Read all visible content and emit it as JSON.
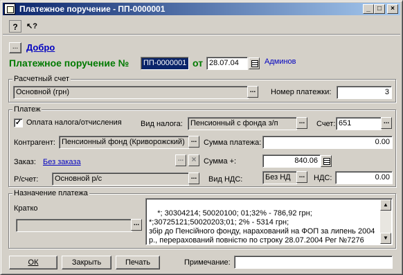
{
  "window": {
    "title": "Платежное поручение - ПП-0000001",
    "min_label": "_",
    "max_label": "□",
    "close_label": "×"
  },
  "toolbar": {
    "help_label": "?",
    "context_help_label": "↖?"
  },
  "header": {
    "status_btn": "...",
    "status_link": "Добро",
    "doc_title": "Платежное поручение №",
    "doc_number": "ПП-0000001",
    "from_label": "от",
    "doc_date": "28.07.04",
    "user_name": "Админов"
  },
  "account_group": {
    "title": "Расчетный счет",
    "account_value": "Основной (грн)",
    "payment_no_label": "Номер платежки:",
    "payment_no_value": "3"
  },
  "payment_group": {
    "title": "Платеж",
    "tax_checkbox_label": "Оплата налога/отчисления",
    "tax_checked": true,
    "tax_type_label": "Вид налога:",
    "tax_type_value": "Пенсионный с фонда з/п",
    "account_label": "Счет:",
    "account_value": "651",
    "counterparty_label": "Контрагент:",
    "counterparty_value": "Пенсионный фонд (Криворожский)",
    "amount_label": "Сумма платежа:",
    "amount_value": "0.00",
    "order_label": "Заказ:",
    "order_link": "Без заказа",
    "sum_plus_label": "Сумма +:",
    "sum_plus_value": "840.06",
    "ps_label": "Р/счет:",
    "ps_value": "Основной р/с",
    "vat_type_label": "Вид НДС:",
    "vat_type_value": "Без НД",
    "vat_label": "НДС:",
    "vat_value": "0.00"
  },
  "purpose_group": {
    "title": "Назначение платежа",
    "short_label": "Кратко",
    "short_value": "",
    "purpose_text": "*; 30304214; 50020100; 01;32% - 786,92 грн;\n*;30725121;50020203;01; 2% - 5314 грн;\nзбір до Пенсійного фонду, нарахований на ФОП за липень 2004 р., перерахований повністю по строку 28.07.2004 Рег №7276"
  },
  "footer": {
    "ok_label": "ОК",
    "close_label": "Закрыть",
    "print_label": "Печать",
    "note_label": "Примечание:",
    "note_value": ""
  },
  "icons": {
    "dots": "...",
    "clear": "×",
    "up": "▲",
    "down": "▼"
  }
}
